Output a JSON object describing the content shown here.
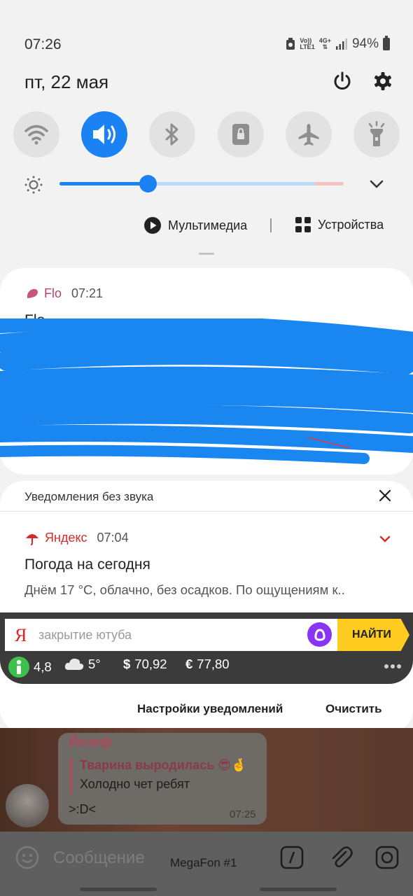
{
  "status_bar": {
    "time": "07:26",
    "volte_top": "Vo))",
    "volte_bottom": "LTE1",
    "net_top": "4G+",
    "net_bottom": "⇅",
    "battery": "94%"
  },
  "header": {
    "date": "пт, 22 мая"
  },
  "quick_toggles": [
    {
      "name": "wifi",
      "active": false
    },
    {
      "name": "sound",
      "active": true
    },
    {
      "name": "bluetooth",
      "active": false
    },
    {
      "name": "rotation-lock",
      "active": false
    },
    {
      "name": "airplane",
      "active": false
    },
    {
      "name": "flashlight",
      "active": false
    }
  ],
  "brightness": {
    "level": 0.31
  },
  "media": {
    "multimedia_label": "Мультимедиа",
    "devices_label": "Устройства"
  },
  "flo_notification": {
    "app": "Flo",
    "time": "07:21",
    "title": "Flo"
  },
  "silent_section": {
    "title": "Уведомления без звука"
  },
  "yandex_notification": {
    "app": "Яндекс",
    "time": "07:04",
    "title": "Погода на сегодня",
    "text": "Днём 17 °C, облачно, без осадков. По ощущениям к.."
  },
  "yandex_widget": {
    "logo": "Я",
    "search_text": "закрытие ютуба",
    "search_button": "НАЙТИ",
    "rating": "4,8",
    "temperature": "5°",
    "usd": "70,92",
    "eur": "77,80",
    "usd_sign": "$",
    "eur_sign": "€"
  },
  "panel_actions": {
    "settings": "Настройки уведомлений",
    "clear": "Очистить"
  },
  "chat": {
    "sender": "Йозеф",
    "quote_sender": "Тварина выродилась 😎🤞",
    "quote_text": "Холодно чет ребят",
    "message": ">:D<",
    "time": "07:25",
    "input_placeholder": "Сообщение"
  },
  "carrier": "MegaFon #1",
  "colors": {
    "accent": "#1a82f2",
    "flo": "#b8436f",
    "yandex": "#d52b2b",
    "yandex_button": "#ffcc1f",
    "alice": "#8a34f4"
  }
}
